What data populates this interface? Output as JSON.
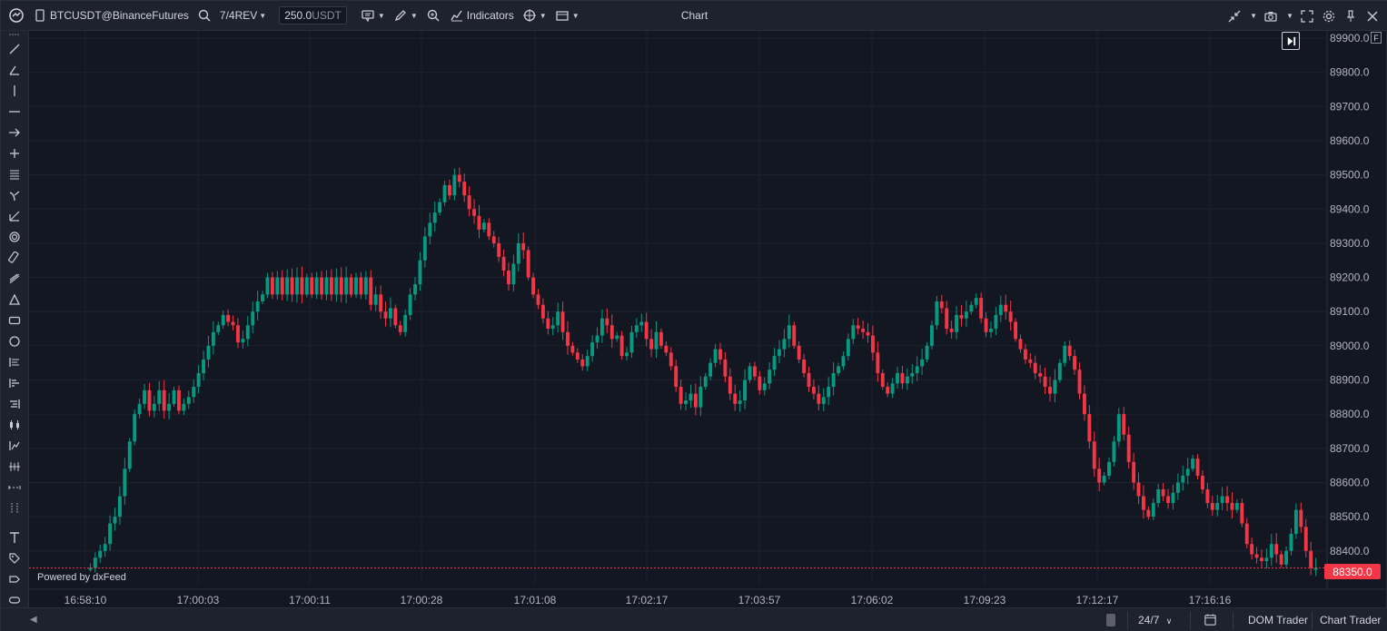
{
  "toolbar": {
    "symbol": "BTCUSDT@BinanceFutures",
    "chart_type": "7/4REV",
    "quantity_value": "250.0",
    "quantity_unit": "USDT",
    "indicators_label": "Indicators",
    "title": "Chart"
  },
  "chart": {
    "powered_by": "Powered by dxFeed",
    "goto_realtime_icon": "skip-to-end-icon",
    "f_badge": "F",
    "last_price_label": "88350.0",
    "colors": {
      "up": "#089981",
      "down": "#f23645",
      "background": "#131722",
      "grid": "#1e2230"
    }
  },
  "bottom": {
    "session": "24/7",
    "dom_trader": "DOM Trader",
    "chart_trader": "Chart Trader"
  },
  "chart_data": {
    "type": "candlestick",
    "y_axis_labels": [
      "89900.0",
      "89800.0",
      "89700.0",
      "89600.0",
      "89500.0",
      "89400.0",
      "89300.0",
      "89200.0",
      "89100.0",
      "89000.0",
      "88900.0",
      "88800.0",
      "88700.0",
      "88600.0",
      "88500.0",
      "88400.0"
    ],
    "ylim": [
      88300,
      89920
    ],
    "last_price": 88350,
    "x_tick_labels": [
      "16:58:10",
      "17:00:03",
      "17:00:11",
      "17:00:28",
      "17:01:08",
      "17:02:17",
      "17:03:57",
      "17:06:02",
      "17:09:23",
      "17:12:17",
      "17:16:16"
    ],
    "closes": [
      88350,
      88350,
      88380,
      88400,
      88420,
      88480,
      88500,
      88560,
      88640,
      88720,
      88800,
      88830,
      88870,
      88810,
      88830,
      88870,
      88810,
      88830,
      88870,
      88810,
      88830,
      88850,
      88880,
      88920,
      88960,
      89000,
      89040,
      89060,
      89090,
      89070,
      89060,
      89010,
      89020,
      89060,
      89100,
      89130,
      89150,
      89200,
      89150,
      89200,
      89150,
      89200,
      89150,
      89200,
      89150,
      89200,
      89150,
      89200,
      89150,
      89200,
      89150,
      89200,
      89150,
      89200,
      89150,
      89200,
      89150,
      89200,
      89120,
      89150,
      89100,
      89080,
      89110,
      89060,
      89040,
      89090,
      89150,
      89180,
      89250,
      89320,
      89360,
      89390,
      89420,
      89470,
      89440,
      89500,
      89480,
      89440,
      89400,
      89380,
      89340,
      89360,
      89320,
      89300,
      89260,
      89220,
      89180,
      89240,
      89300,
      89280,
      89200,
      89150,
      89120,
      89080,
      89050,
      89060,
      89100,
      89040,
      89000,
      88980,
      88960,
      88940,
      88970,
      89010,
      89030,
      89080,
      89060,
      89020,
      89030,
      88970,
      88980,
      89040,
      89060,
      89070,
      89020,
      88990,
      89040,
      89000,
      88980,
      88940,
      88880,
      88830,
      88840,
      88860,
      88820,
      88880,
      88910,
      88950,
      88990,
      88960,
      88910,
      88860,
      88830,
      88840,
      88900,
      88940,
      88910,
      88870,
      88890,
      88930,
      88970,
      88990,
      89020,
      89060,
      89000,
      88960,
      88920,
      88880,
      88860,
      88830,
      88850,
      88880,
      88920,
      88940,
      88970,
      89020,
      89060,
      89050,
      89040,
      89030,
      88980,
      88920,
      88880,
      88860,
      88890,
      88920,
      88890,
      88910,
      88920,
      88940,
      88960,
      89000,
      89060,
      89130,
      89110,
      89050,
      89040,
      89090,
      89080,
      89100,
      89120,
      89140,
      89080,
      89040,
      89050,
      89090,
      89120,
      89100,
      89070,
      89020,
      88990,
      88960,
      88950,
      88920,
      88910,
      88880,
      88860,
      88900,
      88950,
      89000,
      88970,
      88930,
      88860,
      88800,
      88720,
      88640,
      88600,
      88620,
      88660,
      88720,
      88800,
      88740,
      88660,
      88600,
      88560,
      88520,
      88500,
      88540,
      88580,
      88560,
      88540,
      88570,
      88600,
      88620,
      88640,
      88670,
      88620,
      88580,
      88540,
      88520,
      88540,
      88560,
      88540,
      88520,
      88540,
      88480,
      88420,
      88390,
      88380,
      88370,
      88380,
      88420,
      88390,
      88360,
      88400,
      88450,
      88520,
      88470,
      88400,
      88350,
      88350
    ],
    "flat_zones": [
      {
        "label": "red block",
        "from_index": 0,
        "price_top": 88870,
        "price_bottom": 88810
      },
      {
        "label": "green block",
        "from_index": 0,
        "price_top": 89200,
        "price_bottom": 89120
      }
    ]
  }
}
